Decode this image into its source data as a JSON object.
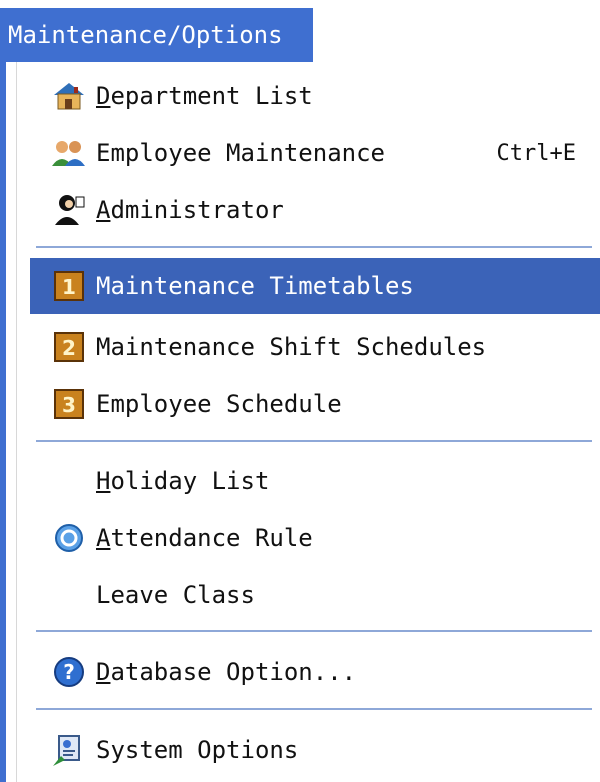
{
  "menu": {
    "title": "Maintenance/Options",
    "items": [
      {
        "pre": "",
        "acc": "D",
        "post": "epartment List",
        "shortcut": ""
      },
      {
        "pre": "Employee Maintenance",
        "acc": "",
        "post": "",
        "shortcut": "Ctrl+E"
      },
      {
        "pre": "",
        "acc": "A",
        "post": "dministrator",
        "shortcut": ""
      },
      {
        "pre": "Maintenance Timetables",
        "acc": "",
        "post": "",
        "shortcut": "",
        "selected": true
      },
      {
        "pre": "Maintenance Shift Schedules",
        "acc": "",
        "post": "",
        "shortcut": ""
      },
      {
        "pre": "Employee Schedule",
        "acc": "",
        "post": "",
        "shortcut": ""
      },
      {
        "pre": "",
        "acc": "H",
        "post": "oliday List",
        "shortcut": ""
      },
      {
        "pre": "",
        "acc": "A",
        "post": "ttendance Rule",
        "shortcut": ""
      },
      {
        "pre": "Leave Class",
        "acc": "",
        "post": "",
        "shortcut": ""
      },
      {
        "pre": "",
        "acc": "D",
        "post": "atabase Option...",
        "shortcut": ""
      },
      {
        "pre": "System Options",
        "acc": "",
        "post": "",
        "shortcut": ""
      }
    ],
    "badges": [
      "1",
      "2",
      "3"
    ]
  },
  "colors": {
    "accent": "#3f6fd0",
    "selection": "#3b63b8",
    "separator": "#8ea8d8"
  }
}
